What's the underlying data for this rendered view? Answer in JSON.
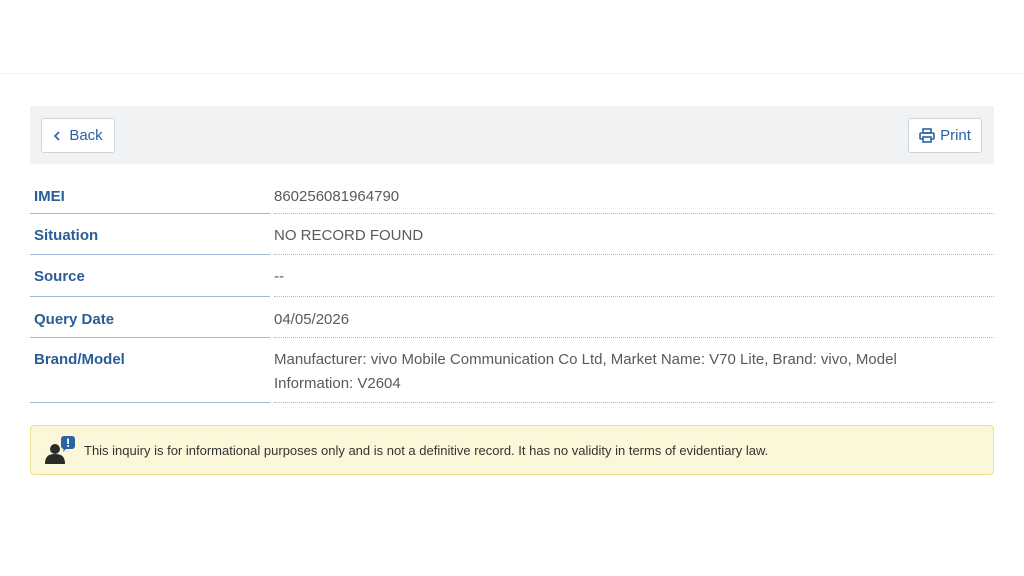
{
  "toolbar": {
    "back_label": "Back",
    "print_label": "Print"
  },
  "details": {
    "rows": [
      {
        "label": "IMEI",
        "value": "860256081964790"
      },
      {
        "label": "Situation",
        "value": "NO RECORD FOUND"
      },
      {
        "label": "Source",
        "value": "--"
      },
      {
        "label": "Query Date",
        "value": "04/05/2026"
      },
      {
        "label": "Brand/Model",
        "value": "Manufacturer: vivo Mobile Communication Co Ltd, Market Name: V70 Lite, Brand: vivo, Model Information: V2604"
      }
    ]
  },
  "notice": {
    "text": "This inquiry is for informational purposes only and is not a definitive record. It has no validity in terms of evidentiary law."
  },
  "icons": {
    "back": "chevron-left-icon",
    "print": "printer-icon",
    "notice": "user-info-icon"
  },
  "colors": {
    "accent": "#2a62a4",
    "label": "#2a5d98",
    "notice_bg": "#fcf7d9",
    "notice_border": "#ece08a"
  }
}
